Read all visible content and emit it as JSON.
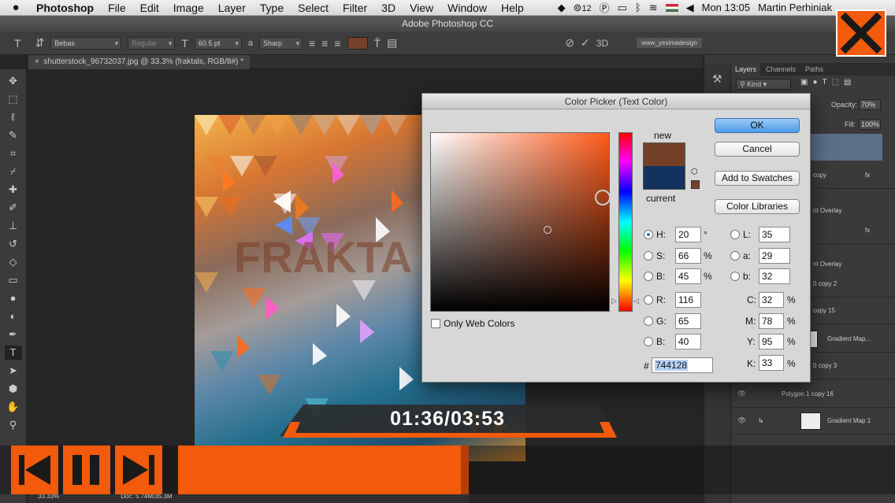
{
  "menubar": {
    "apple": "",
    "app": "Photoshop",
    "items": [
      "File",
      "Edit",
      "Image",
      "Layer",
      "Type",
      "Select",
      "Filter",
      "3D",
      "View",
      "Window",
      "Help"
    ],
    "status_badge": "12",
    "clock": "Mon 13:05",
    "user": "Martin Perhiniak"
  },
  "window": {
    "title": "Adobe Photoshop CC"
  },
  "options": {
    "font_family": "Bebas",
    "font_style": "Regular",
    "font_size": "60.5 pt",
    "aa_label": "a",
    "antialias": "Sharp",
    "threed": "3D",
    "url": "www_yesimadesign"
  },
  "document": {
    "tab": "shutterstock_96732037.jpg @ 33.3% (fraktals, RGB/8#) *"
  },
  "layers": {
    "tabs": [
      "Layers",
      "Channels",
      "Paths"
    ],
    "kind": "Kind",
    "opacity_label": "Opacity:",
    "opacity": "70%",
    "fill_label": "Fill:",
    "fill": "100%",
    "rows": [
      {
        "name": "copy"
      },
      {
        "name": "nt Overlay"
      },
      {
        "name": "nt Overlay"
      },
      {
        "name": "0 copy 2"
      },
      {
        "name": "copy 15"
      },
      {
        "name": "Gradient Map..."
      },
      {
        "name": "0 copy 3"
      },
      {
        "name": "Polygon 1 copy 16"
      },
      {
        "name": "Gradient Map 1"
      }
    ]
  },
  "dialog": {
    "title": "Color Picker (Text Color)",
    "ok": "OK",
    "cancel": "Cancel",
    "add_swatches": "Add to Swatches",
    "color_libraries": "Color Libraries",
    "new_label": "new",
    "current_label": "current",
    "only_web": "Only Web Colors",
    "new_color": "#744128",
    "current_color": "#13325e",
    "fields": {
      "H": "20",
      "S": "66",
      "B": "45",
      "R": "116",
      "G": "65",
      "Bv": "40",
      "L": "35",
      "a": "29",
      "b": "32",
      "C": "32",
      "M": "78",
      "Y": "95",
      "K": "33"
    },
    "units": {
      "deg": "°",
      "pct": "%"
    },
    "hex": "744128"
  },
  "video": {
    "time": "01:36/03:53",
    "progress": 0.41
  },
  "statusbar": {
    "zoom": "33.33%",
    "doc": "Doc: 5.74M/35.3M"
  },
  "colors": {
    "accent": "#f25a0c"
  }
}
